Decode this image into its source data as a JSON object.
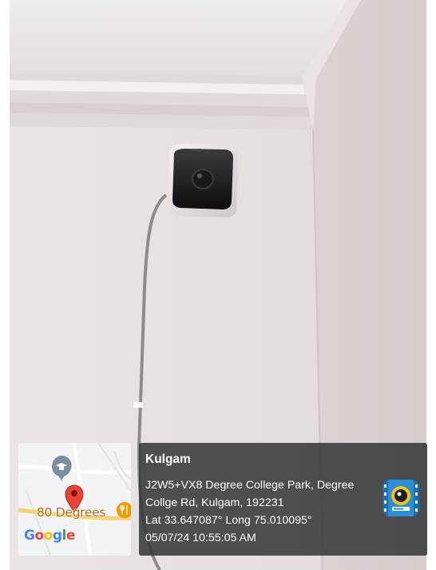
{
  "map": {
    "place_label": "80 Degrees",
    "brand": {
      "g": "G",
      "o1": "o",
      "o2": "o",
      "g2": "g",
      "l": "l",
      "e": "e"
    },
    "icons": [
      "school-pin-icon",
      "location-pin-icon",
      "restaurant-icon"
    ]
  },
  "location": {
    "title": "Kulgam",
    "address_line1": "J2W5+VX8 Degree College Park, Degree",
    "address_line2": "Collge Rd, Kulgam, 192231",
    "coordinates": "Lat 33.647087° Long 75.010095°",
    "timestamp": "05/07/24 10:55:05 AM"
  },
  "app": {
    "icon": "gps-camera-app-icon"
  },
  "colors": {
    "wall": "#e7e1e1",
    "overlay": "#363636",
    "pin_red": "#ea4335",
    "map_road_yellow": "#f6d36b"
  }
}
